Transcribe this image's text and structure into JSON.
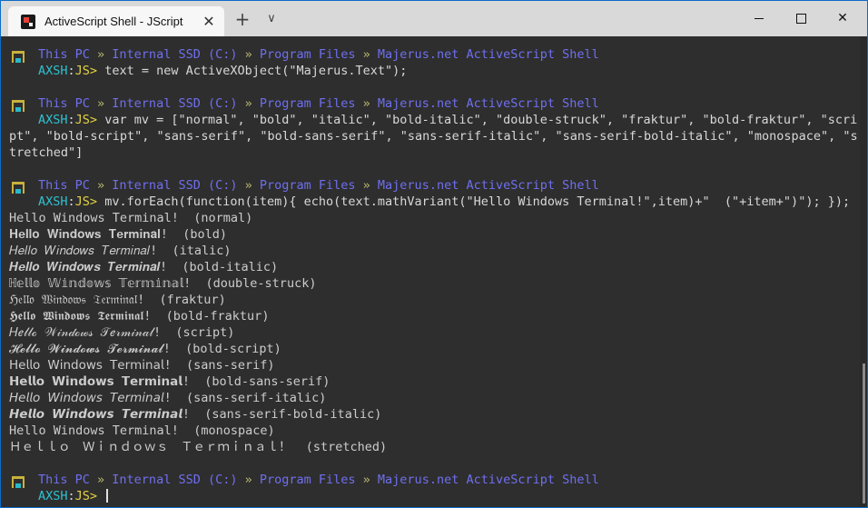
{
  "window": {
    "tab_title": "ActiveScript Shell - JScript",
    "tab_close": "✕",
    "new_tab": "+",
    "dropdown": "∨",
    "close": "✕"
  },
  "prompt": {
    "path": [
      "This PC",
      "Internal SSD (C:)",
      "Program Files",
      "Majerus.net ActiveScript Shell"
    ],
    "separator": " » ",
    "user": "AXSH",
    "colon": ":",
    "lang": "JS",
    "gt": "> "
  },
  "commands": [
    "text = new ActiveXObject(\"Majerus.Text\");",
    "var mv = [\"normal\", \"bold\", \"italic\", \"bold-italic\", \"double-struck\", \"fraktur\", \"bold-fraktur\", \"scri",
    "mv.forEach(function(item){ echo(text.mathVariant(\"Hello Windows Terminal!\",item)+\"  (\"+item+\")\"); });"
  ],
  "command2_wrap": [
    "pt\", \"bold-script\", \"sans-serif\", \"bold-sans-serif\", \"sans-serif-italic\", \"sans-serif-bold-italic\", \"monospace\", \"s",
    "tretched\"]"
  ],
  "output": [
    "Hello Windows Terminal!  (normal)",
    "𝐇𝐞𝐥𝐥𝐨 𝐖𝐢𝐧𝐝𝐨𝐰𝐬 𝐓𝐞𝐫𝐦𝐢𝐧𝐚𝐥!  (bold)",
    "𝐻𝑒𝑙𝑙𝑜 𝑊𝑖𝑛𝑑𝑜𝑤𝑠 𝑇𝑒𝑟𝑚𝑖𝑛𝑎𝑙!  (italic)",
    "𝑯𝒆𝒍𝒍𝒐 𝑾𝒊𝒏𝒅𝒐𝒘𝒔 𝑻𝒆𝒓𝒎𝒊𝒏𝒂𝒍!  (bold-italic)",
    "ℍ𝕖𝕝𝕝𝕠 𝕎𝕚𝕟𝕕𝕠𝕨𝕤 𝕋𝕖𝕣𝕞𝕚𝕟𝕒𝕝!  (double-struck)",
    "ℌ𝔢𝔩𝔩𝔬 𝔚𝔦𝔫𝔡𝔬𝔴𝔰 𝔗𝔢𝔯𝔪𝔦𝔫𝔞𝔩!  (fraktur)",
    "𝕳𝖊𝖑𝖑𝖔 𝖂𝖎𝖓𝖉𝖔𝖜𝖘 𝕿𝖊𝖗𝖒𝖎𝖓𝖆𝖑!  (bold-fraktur)",
    "𝐻ℯ𝓁𝓁ℴ 𝒲𝒾𝓃𝒹ℴ𝓌𝓈 𝒯ℯ𝓇𝓂𝒾𝓃𝒶𝓁!  (script)",
    "𝓗𝓮𝓵𝓵𝓸 𝓦𝓲𝓷𝓭𝓸𝔀𝓼 𝓣𝓮𝓻𝓶𝓲𝓷𝓪𝓵!  (bold-script)",
    "𝖧𝖾𝗅𝗅𝗈 𝖶𝗂𝗇𝖽𝗈𝗐𝗌 𝖳𝖾𝗋𝗆𝗂𝗇𝖺𝗅!  (sans-serif)",
    "𝗛𝗲𝗹𝗹𝗼 𝗪𝗶𝗻𝗱𝗼𝘄𝘀 𝗧𝗲𝗿𝗺𝗶𝗻𝗮𝗹!  (bold-sans-serif)",
    "𝘏𝘦𝘭𝘭𝘰 𝘞𝘪𝘯𝘥𝘰𝘸𝘴 𝘛𝘦𝘳𝘮𝘪𝘯𝘢𝘭!  (sans-serif-italic)",
    "𝙃𝙚𝙡𝙡𝙤 𝙒𝙞𝙣𝙙𝙤𝙬𝙨 𝙏𝙚𝙧𝙢𝙞𝙣𝙖𝙡!  (sans-serif-bold-italic)",
    "𝙷𝚎𝚕𝚕𝚘 𝚆𝚒𝚗𝚍𝚘𝚠𝚜 𝚃𝚎𝚛𝚖𝚒𝚗𝚊𝚕!  (monospace)",
    "Ｈｅｌｌｏ　Ｗｉｎｄｏｗｓ　Ｔｅｒｍｉｎａｌ！  (stretched)"
  ],
  "colors": {
    "path": "#6f6ff0",
    "separator": "#b9b970",
    "user": "#2fc1d0",
    "lang": "#e4d341",
    "background": "#2e2e2e"
  },
  "icons": {
    "prompt_icon": "folder-icon",
    "app_icon": "terminal-app-icon"
  }
}
